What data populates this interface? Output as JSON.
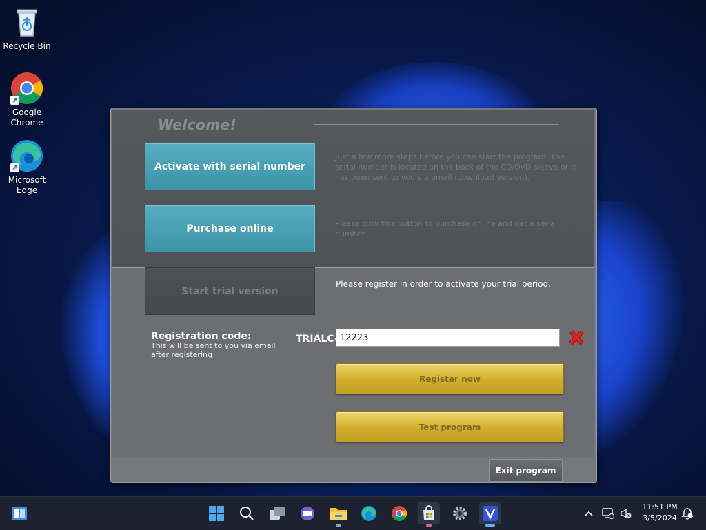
{
  "desktop": {
    "icons": [
      {
        "label": "Recycle Bin"
      },
      {
        "label": "Google Chrome"
      },
      {
        "label": "Microsoft Edge"
      }
    ]
  },
  "dialog": {
    "welcome": "Welcome!",
    "activate_button": "Activate with serial number",
    "activate_desc": "Just a few more steps before you can start the program. The serial number is located on the back of the CD/DVD sleeve or it has been sent to you via email (download version).",
    "purchase_button": "Purchase online",
    "purchase_desc": "Please click this button to purchase online and get a serial number.",
    "trial_button": "Start trial version",
    "trial_note": "Please register in order to activate your trial period.",
    "reg_title": "Registration code:",
    "reg_sub": "This will be sent to you via email after registering",
    "code_prefix": "TRIALC-",
    "code_value": "12223",
    "register_button": "Register now",
    "test_button": "Test program",
    "exit_button": "Exit program"
  },
  "taskbar": {
    "time": "11:51 PM",
    "date": "3/5/2024",
    "apps": [
      "widgets-icon",
      "start-icon",
      "search-icon",
      "task-view-icon",
      "teams-chat-icon",
      "file-explorer-icon",
      "edge-icon",
      "chrome-icon",
      "store-icon",
      "settings-icon",
      "v-app-icon"
    ]
  },
  "colors": {
    "teal_button": "#4aa2b5",
    "gold_button": "#d6b43a",
    "dialog_bg": "#76787c"
  }
}
